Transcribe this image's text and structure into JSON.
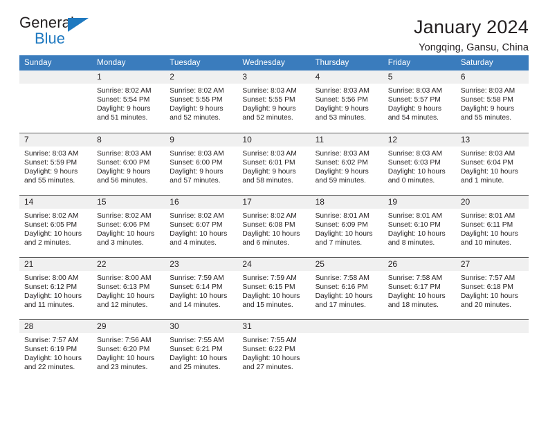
{
  "brand": {
    "name_part1": "General",
    "name_part2": "Blue",
    "triangle_color": "#1f79c0"
  },
  "header": {
    "title": "January 2024",
    "subtitle": "Yongqing, Gansu, China",
    "accent_color": "#3a7cbd"
  },
  "weekday_headers": [
    "Sunday",
    "Monday",
    "Tuesday",
    "Wednesday",
    "Thursday",
    "Friday",
    "Saturday"
  ],
  "labels": {
    "sunrise_prefix": "Sunrise:",
    "sunset_prefix": "Sunset:",
    "daylight_prefix": "Daylight:"
  },
  "weeks": [
    [
      {
        "day": "",
        "lines": []
      },
      {
        "day": "1",
        "lines": [
          "Sunrise: 8:02 AM",
          "Sunset: 5:54 PM",
          "Daylight: 9 hours",
          "and 51 minutes."
        ]
      },
      {
        "day": "2",
        "lines": [
          "Sunrise: 8:02 AM",
          "Sunset: 5:55 PM",
          "Daylight: 9 hours",
          "and 52 minutes."
        ]
      },
      {
        "day": "3",
        "lines": [
          "Sunrise: 8:03 AM",
          "Sunset: 5:55 PM",
          "Daylight: 9 hours",
          "and 52 minutes."
        ]
      },
      {
        "day": "4",
        "lines": [
          "Sunrise: 8:03 AM",
          "Sunset: 5:56 PM",
          "Daylight: 9 hours",
          "and 53 minutes."
        ]
      },
      {
        "day": "5",
        "lines": [
          "Sunrise: 8:03 AM",
          "Sunset: 5:57 PM",
          "Daylight: 9 hours",
          "and 54 minutes."
        ]
      },
      {
        "day": "6",
        "lines": [
          "Sunrise: 8:03 AM",
          "Sunset: 5:58 PM",
          "Daylight: 9 hours",
          "and 55 minutes."
        ]
      }
    ],
    [
      {
        "day": "7",
        "lines": [
          "Sunrise: 8:03 AM",
          "Sunset: 5:59 PM",
          "Daylight: 9 hours",
          "and 55 minutes."
        ]
      },
      {
        "day": "8",
        "lines": [
          "Sunrise: 8:03 AM",
          "Sunset: 6:00 PM",
          "Daylight: 9 hours",
          "and 56 minutes."
        ]
      },
      {
        "day": "9",
        "lines": [
          "Sunrise: 8:03 AM",
          "Sunset: 6:00 PM",
          "Daylight: 9 hours",
          "and 57 minutes."
        ]
      },
      {
        "day": "10",
        "lines": [
          "Sunrise: 8:03 AM",
          "Sunset: 6:01 PM",
          "Daylight: 9 hours",
          "and 58 minutes."
        ]
      },
      {
        "day": "11",
        "lines": [
          "Sunrise: 8:03 AM",
          "Sunset: 6:02 PM",
          "Daylight: 9 hours",
          "and 59 minutes."
        ]
      },
      {
        "day": "12",
        "lines": [
          "Sunrise: 8:03 AM",
          "Sunset: 6:03 PM",
          "Daylight: 10 hours",
          "and 0 minutes."
        ]
      },
      {
        "day": "13",
        "lines": [
          "Sunrise: 8:03 AM",
          "Sunset: 6:04 PM",
          "Daylight: 10 hours",
          "and 1 minute."
        ]
      }
    ],
    [
      {
        "day": "14",
        "lines": [
          "Sunrise: 8:02 AM",
          "Sunset: 6:05 PM",
          "Daylight: 10 hours",
          "and 2 minutes."
        ]
      },
      {
        "day": "15",
        "lines": [
          "Sunrise: 8:02 AM",
          "Sunset: 6:06 PM",
          "Daylight: 10 hours",
          "and 3 minutes."
        ]
      },
      {
        "day": "16",
        "lines": [
          "Sunrise: 8:02 AM",
          "Sunset: 6:07 PM",
          "Daylight: 10 hours",
          "and 4 minutes."
        ]
      },
      {
        "day": "17",
        "lines": [
          "Sunrise: 8:02 AM",
          "Sunset: 6:08 PM",
          "Daylight: 10 hours",
          "and 6 minutes."
        ]
      },
      {
        "day": "18",
        "lines": [
          "Sunrise: 8:01 AM",
          "Sunset: 6:09 PM",
          "Daylight: 10 hours",
          "and 7 minutes."
        ]
      },
      {
        "day": "19",
        "lines": [
          "Sunrise: 8:01 AM",
          "Sunset: 6:10 PM",
          "Daylight: 10 hours",
          "and 8 minutes."
        ]
      },
      {
        "day": "20",
        "lines": [
          "Sunrise: 8:01 AM",
          "Sunset: 6:11 PM",
          "Daylight: 10 hours",
          "and 10 minutes."
        ]
      }
    ],
    [
      {
        "day": "21",
        "lines": [
          "Sunrise: 8:00 AM",
          "Sunset: 6:12 PM",
          "Daylight: 10 hours",
          "and 11 minutes."
        ]
      },
      {
        "day": "22",
        "lines": [
          "Sunrise: 8:00 AM",
          "Sunset: 6:13 PM",
          "Daylight: 10 hours",
          "and 12 minutes."
        ]
      },
      {
        "day": "23",
        "lines": [
          "Sunrise: 7:59 AM",
          "Sunset: 6:14 PM",
          "Daylight: 10 hours",
          "and 14 minutes."
        ]
      },
      {
        "day": "24",
        "lines": [
          "Sunrise: 7:59 AM",
          "Sunset: 6:15 PM",
          "Daylight: 10 hours",
          "and 15 minutes."
        ]
      },
      {
        "day": "25",
        "lines": [
          "Sunrise: 7:58 AM",
          "Sunset: 6:16 PM",
          "Daylight: 10 hours",
          "and 17 minutes."
        ]
      },
      {
        "day": "26",
        "lines": [
          "Sunrise: 7:58 AM",
          "Sunset: 6:17 PM",
          "Daylight: 10 hours",
          "and 18 minutes."
        ]
      },
      {
        "day": "27",
        "lines": [
          "Sunrise: 7:57 AM",
          "Sunset: 6:18 PM",
          "Daylight: 10 hours",
          "and 20 minutes."
        ]
      }
    ],
    [
      {
        "day": "28",
        "lines": [
          "Sunrise: 7:57 AM",
          "Sunset: 6:19 PM",
          "Daylight: 10 hours",
          "and 22 minutes."
        ]
      },
      {
        "day": "29",
        "lines": [
          "Sunrise: 7:56 AM",
          "Sunset: 6:20 PM",
          "Daylight: 10 hours",
          "and 23 minutes."
        ]
      },
      {
        "day": "30",
        "lines": [
          "Sunrise: 7:55 AM",
          "Sunset: 6:21 PM",
          "Daylight: 10 hours",
          "and 25 minutes."
        ]
      },
      {
        "day": "31",
        "lines": [
          "Sunrise: 7:55 AM",
          "Sunset: 6:22 PM",
          "Daylight: 10 hours",
          "and 27 minutes."
        ]
      },
      {
        "day": "",
        "lines": []
      },
      {
        "day": "",
        "lines": []
      },
      {
        "day": "",
        "lines": []
      }
    ]
  ]
}
